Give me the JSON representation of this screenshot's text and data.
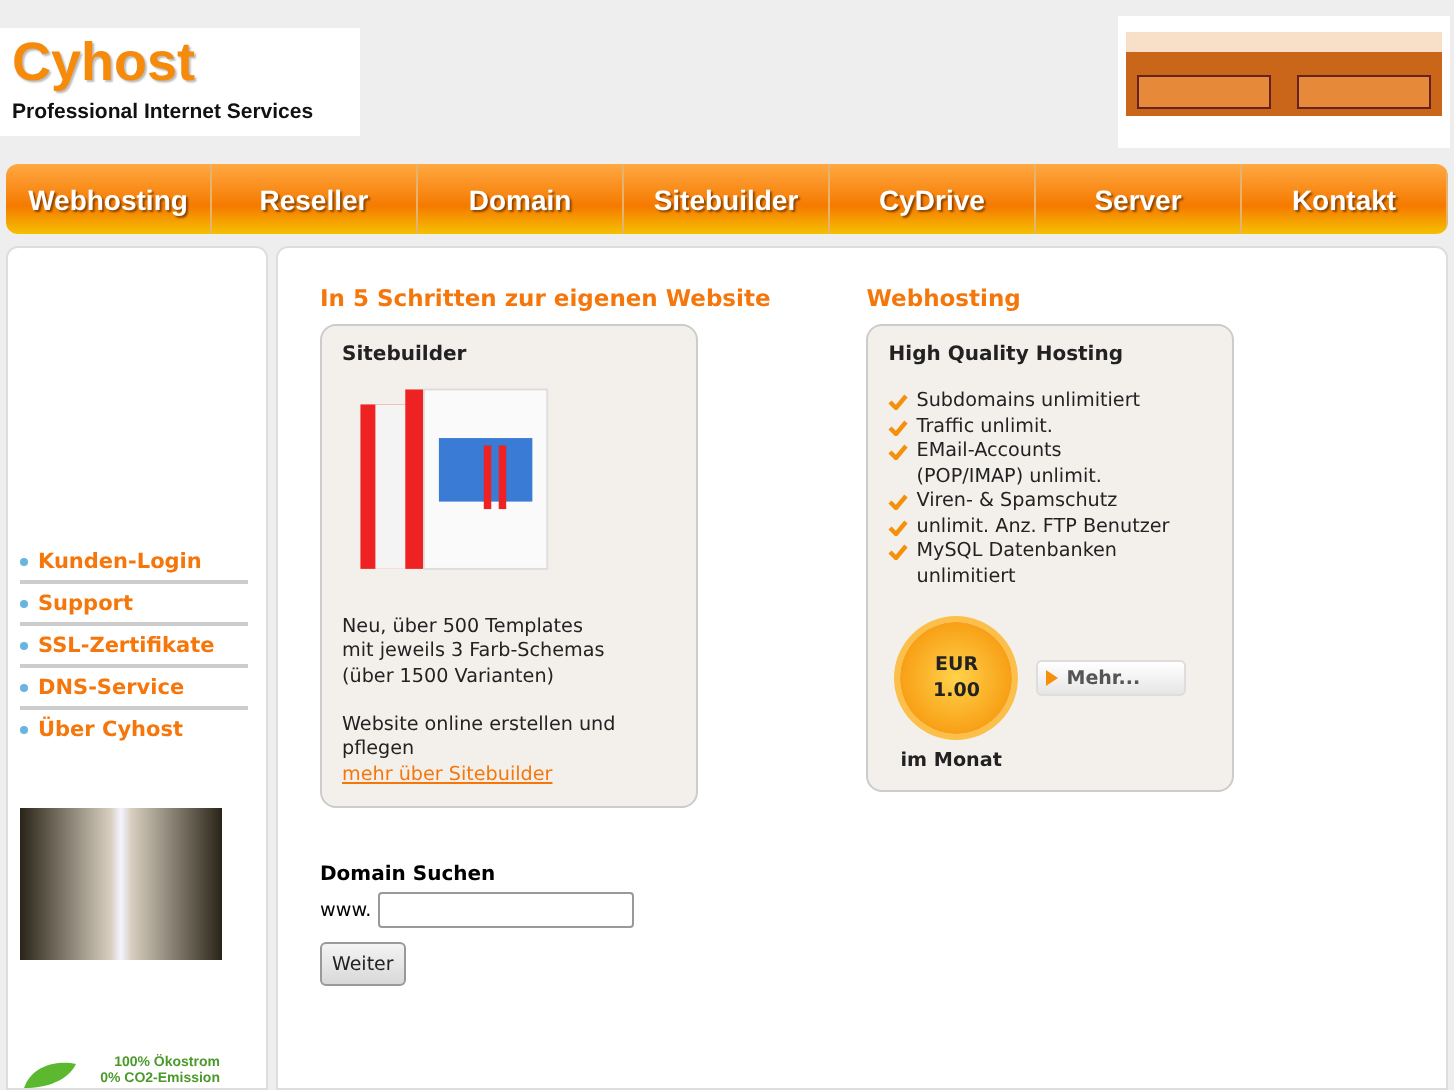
{
  "logo": {
    "name": "Cyhost",
    "tagline": "Professional Internet Services"
  },
  "nav": [
    {
      "label": "Webhosting"
    },
    {
      "label": "Reseller"
    },
    {
      "label": "Domain"
    },
    {
      "label": "Sitebuilder"
    },
    {
      "label": "CyDrive"
    },
    {
      "label": "Server"
    },
    {
      "label": "Kontakt"
    }
  ],
  "sidebar": {
    "links": [
      "Kunden-Login",
      "Support",
      "SSL-Zertifikate",
      "DNS-Service",
      "Über Cyhost"
    ],
    "eco": [
      "100% Ökostrom",
      "0% CO2-Emission"
    ]
  },
  "sitebuilder": {
    "heading": "In 5 Schritten zur eigenen Website",
    "title": "Sitebuilder",
    "lines": [
      "Neu, über 500 Templates",
      "mit jeweils 3 Farb-Schemas",
      "(über 1500 Varianten)"
    ],
    "tagline": "Website online erstellen und pflegen",
    "link": "mehr über Sitebuilder"
  },
  "webhosting": {
    "heading": "Webhosting",
    "title": "High Quality Hosting",
    "features": [
      "Subdomains unlimitiert",
      "Traffic unlimit.",
      "EMail-Accounts\n(POP/IMAP) unlimit.",
      "Viren- & Spamschutz",
      "unlimit. Anz. FTP Benutzer",
      "MySQL Datenbanken unlimitiert"
    ],
    "price_currency": "EUR",
    "price": "1.00",
    "period": "im Monat",
    "more_button": "Mehr..."
  },
  "domain_search": {
    "title": "Domain Suchen",
    "prefix": "www.",
    "button": "Weiter"
  }
}
